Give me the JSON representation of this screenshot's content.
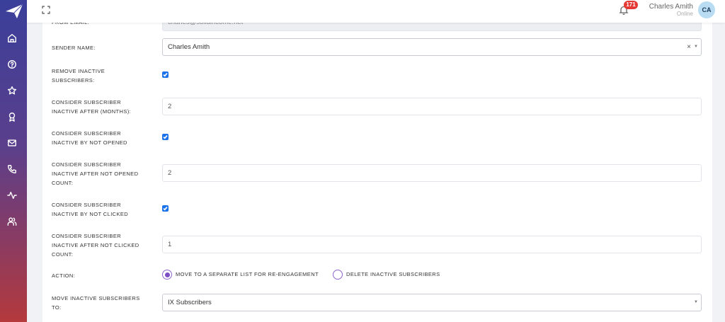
{
  "topbar": {
    "notification_count": "171",
    "user_name": "Charles Amith",
    "user_status": "Online",
    "avatar_initials": "CA"
  },
  "sidebar": {
    "icons": [
      "home-icon",
      "help-icon",
      "star-icon",
      "award-icon",
      "mail-icon",
      "phone-icon",
      "activity-icon",
      "users-icon"
    ]
  },
  "form": {
    "from_email_label": "FROM EMAIL:",
    "from_email_value": "charles@solidincome.net",
    "sender_name_label": "SENDER NAME:",
    "sender_name_value": "Charles Amith",
    "sender_name_clear": "×",
    "remove_inactive_label_1": "REMOVE INACTIVE",
    "remove_inactive_label_2": "SUBSCRIBERS:",
    "remove_inactive_checked": true,
    "inactive_after_months_label_1": "CONSIDER SUBSCRIBER",
    "inactive_after_months_label_2": "INACTIVE AFTER (MONTHS):",
    "inactive_after_months_value": "2",
    "inactive_not_opened_label_1": "CONSIDER SUBSCRIBER",
    "inactive_not_opened_label_2": "INACTIVE BY NOT OPENED",
    "inactive_not_opened_checked": true,
    "not_opened_count_label_1": "CONSIDER SUBSCRIBER",
    "not_opened_count_label_2": "INACTIVE AFTER NOT OPENED",
    "not_opened_count_label_3": "COUNT:",
    "not_opened_count_value": "2",
    "inactive_not_clicked_label_1": "CONSIDER SUBSCRIBER",
    "inactive_not_clicked_label_2": "INACTIVE BY NOT CLICKED",
    "inactive_not_clicked_checked": true,
    "not_clicked_count_label_1": "CONSIDER SUBSCRIBER",
    "not_clicked_count_label_2": "INACTIVE AFTER NOT CLICKED",
    "not_clicked_count_label_3": "COUNT:",
    "not_clicked_count_value": "1",
    "action_label": "ACTION:",
    "action_option_1": "MOVE TO A SEPARATE LIST FOR RE-ENGAGEMENT",
    "action_option_2": "DELETE INACTIVE SUBSCRIBERS",
    "action_selected": "MOVE TO A SEPARATE LIST FOR RE-ENGAGEMENT",
    "move_to_label_1": "MOVE INACTIVE SUBSCRIBERS",
    "move_to_label_2": "TO:",
    "move_to_value": "IX Subscribers"
  },
  "colors": {
    "accent": "#7e4fc4",
    "checkbox": "#1a73e8",
    "badge": "#e53935"
  }
}
